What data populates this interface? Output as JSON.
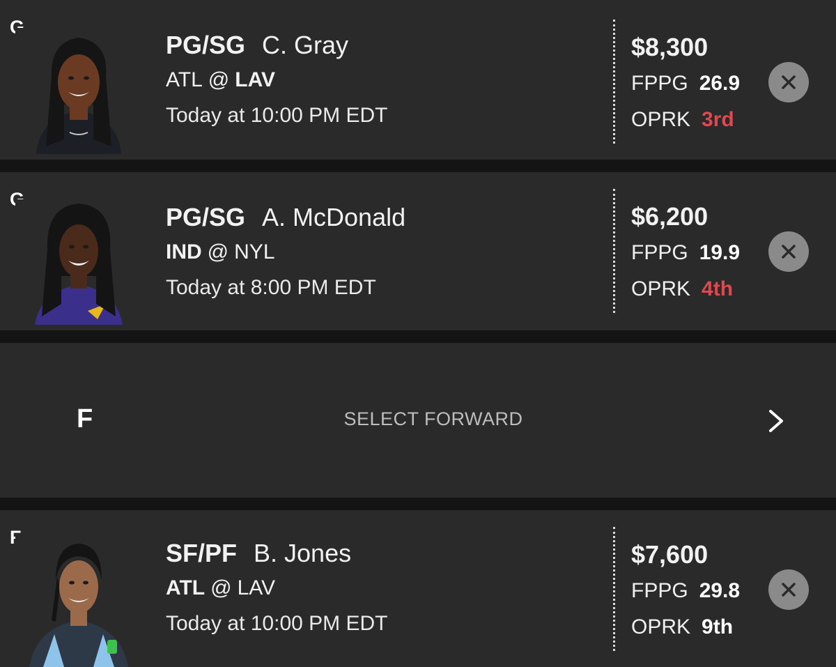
{
  "slots": [
    {
      "slot_label": "G",
      "positions": "PG/SG",
      "player_name": "C. Gray",
      "away_team": "ATL",
      "home_team": "LAV",
      "bold_team": "home",
      "game_time": "Today at 10:00 PM EDT",
      "salary": "$8,300",
      "fppg_label": "FPPG",
      "fppg_value": "26.9",
      "oprk_label": "OPRK",
      "oprk_value": "3rd",
      "oprk_color": "#e0474f"
    },
    {
      "slot_label": "G",
      "positions": "PG/SG",
      "player_name": "A. McDonald",
      "away_team": "IND",
      "home_team": "NYL",
      "bold_team": "away",
      "game_time": "Today at 8:00 PM EDT",
      "salary": "$6,200",
      "fppg_label": "FPPG",
      "fppg_value": "19.9",
      "oprk_label": "OPRK",
      "oprk_value": "4th",
      "oprk_color": "#e0474f"
    },
    {
      "slot_label": "F",
      "empty": true,
      "select_text": "SELECT FORWARD"
    },
    {
      "slot_label": "F",
      "positions": "SF/PF",
      "player_name": "B. Jones",
      "away_team": "ATL",
      "home_team": "LAV",
      "bold_team": "away",
      "game_time": "Today at 10:00 PM EDT",
      "salary": "$7,600",
      "fppg_label": "FPPG",
      "fppg_value": "29.8",
      "oprk_label": "OPRK",
      "oprk_value": "9th",
      "oprk_color": "#ffffff"
    }
  ],
  "at_symbol": "@",
  "icons": {
    "remove": "close-icon",
    "select": "chevron-right-icon",
    "headshot": "player-headshot"
  },
  "colors": {
    "background": "#141414",
    "row": "#2a2a2a",
    "rank_red": "#e0474f",
    "remove_button": "#8a8a8a"
  }
}
